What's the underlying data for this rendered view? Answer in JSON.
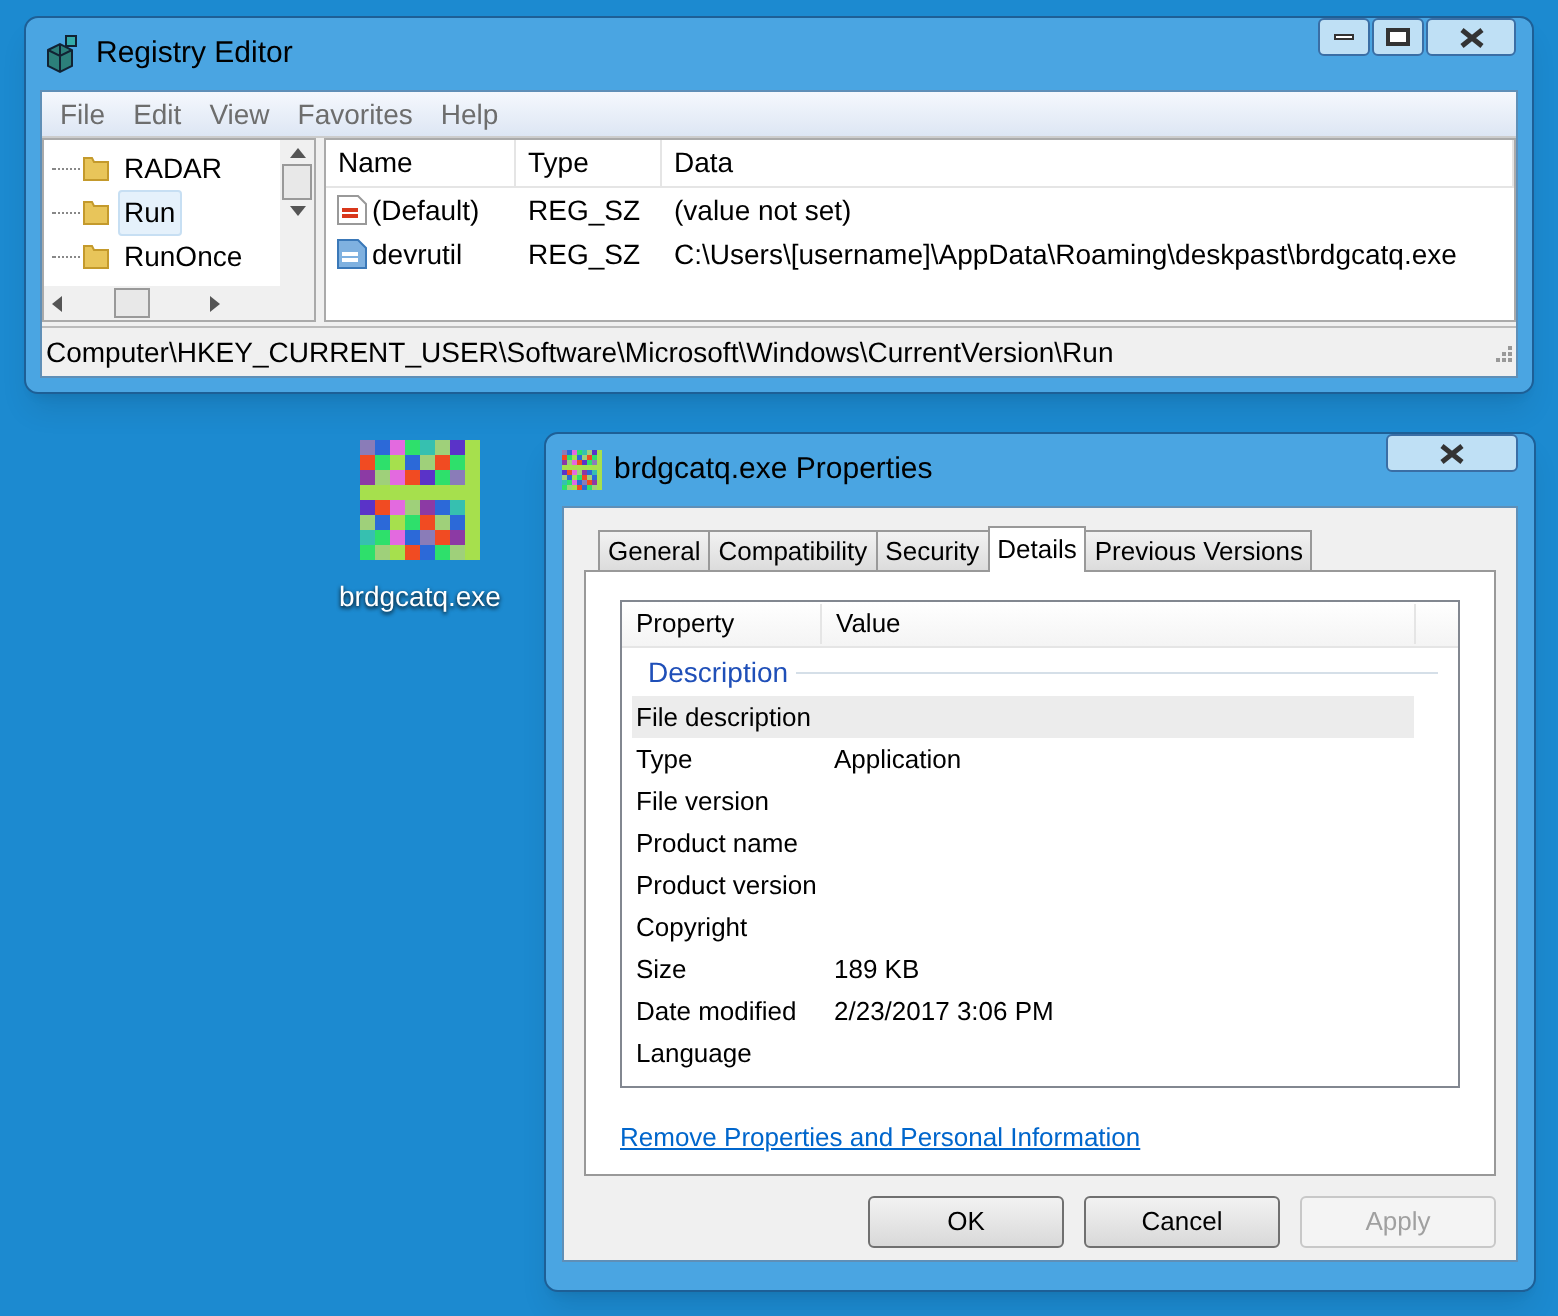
{
  "registry_editor": {
    "title": "Registry Editor",
    "menu": [
      "File",
      "Edit",
      "View",
      "Favorites",
      "Help"
    ],
    "tree": [
      {
        "label": "RADAR",
        "selected": false
      },
      {
        "label": "Run",
        "selected": true
      },
      {
        "label": "RunOnce",
        "selected": false
      }
    ],
    "columns": [
      "Name",
      "Type",
      "Data"
    ],
    "values": [
      {
        "name": "(Default)",
        "type": "REG_SZ",
        "data": "(value not set)",
        "kind": "default"
      },
      {
        "name": "devrutil",
        "type": "REG_SZ",
        "data": "C:\\Users\\[username]\\AppData\\Roaming\\deskpast\\brdgcatq.exe",
        "kind": "string"
      }
    ],
    "status_bar": "Computer\\HKEY_CURRENT_USER\\Software\\Microsoft\\Windows\\CurrentVersion\\Run"
  },
  "desktop_icon": {
    "label": "brdgcatq.exe"
  },
  "properties": {
    "title": "brdgcatq.exe Properties",
    "tabs": [
      {
        "label": "General",
        "selected": false
      },
      {
        "label": "Compatibility",
        "selected": false
      },
      {
        "label": "Security",
        "selected": false
      },
      {
        "label": "Details",
        "selected": true
      },
      {
        "label": "Previous Versions",
        "selected": false
      }
    ],
    "columns": [
      "Property",
      "Value"
    ],
    "section": "Description",
    "rows": [
      {
        "property": "File description",
        "value": "",
        "selected": true
      },
      {
        "property": "Type",
        "value": "Application",
        "selected": false
      },
      {
        "property": "File version",
        "value": "",
        "selected": false
      },
      {
        "property": "Product name",
        "value": "",
        "selected": false
      },
      {
        "property": "Product version",
        "value": "",
        "selected": false
      },
      {
        "property": "Copyright",
        "value": "",
        "selected": false
      },
      {
        "property": "Size",
        "value": "189 KB",
        "selected": false
      },
      {
        "property": "Date modified",
        "value": "2/23/2017 3:06 PM",
        "selected": false
      },
      {
        "property": "Language",
        "value": "",
        "selected": false
      }
    ],
    "link": "Remove Properties and Personal Information",
    "buttons": [
      {
        "label": "OK",
        "disabled": false
      },
      {
        "label": "Cancel",
        "disabled": false
      },
      {
        "label": "Apply",
        "disabled": true
      }
    ]
  }
}
